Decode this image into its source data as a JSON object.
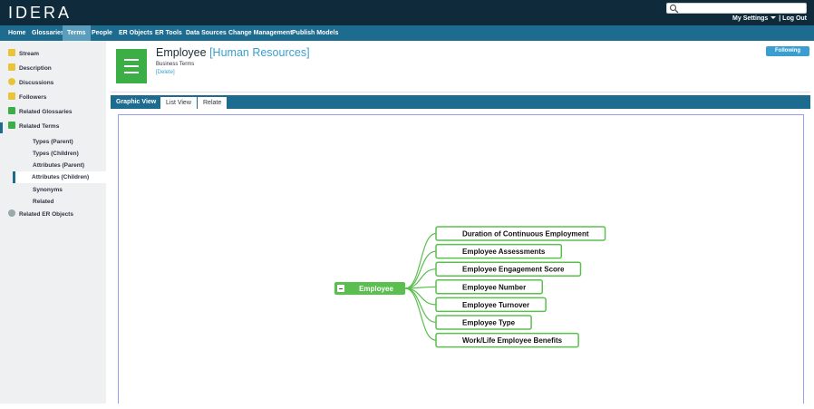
{
  "app": {
    "logo": "IDERA"
  },
  "header": {
    "search_placeholder": "",
    "settings_label": "My Settings",
    "separator": "|",
    "logout_label": "Log Out"
  },
  "nav": {
    "items": [
      "Home",
      "Glossaries",
      "Terms",
      "People",
      "ER Objects",
      "ER Tools",
      "Data Sources",
      "Change Management",
      "Publish Models"
    ],
    "active": "Terms"
  },
  "sidebar": {
    "items": [
      {
        "label": "Stream",
        "icon": "stream-icon",
        "color": "#e9c43a"
      },
      {
        "label": "Description",
        "icon": "description-icon",
        "color": "#e9c43a"
      },
      {
        "label": "Discussions",
        "icon": "discussions-icon",
        "color": "#e9c43a"
      },
      {
        "label": "Followers",
        "icon": "followers-icon",
        "color": "#e9c43a"
      },
      {
        "label": "Related Glossaries",
        "icon": "glossary-icon",
        "color": "#3cae46"
      },
      {
        "label": "Related Terms",
        "icon": "terms-icon",
        "color": "#3cae46"
      },
      {
        "label": "Related ER Objects",
        "icon": "er-objects-icon",
        "color": "#9aa"
      }
    ],
    "sub_items": [
      "Types (Parent)",
      "Types (Children)",
      "Attributes (Parent)",
      "Attributes (Children)",
      "Synonyms",
      "Related"
    ],
    "selected_sub": "Attributes (Children)"
  },
  "term": {
    "name": "Employee",
    "domain": "[Human Resources]",
    "category": "Business Terms",
    "delete_label": "[Delete]",
    "follow_label": "Following",
    "accent": "#3cae46"
  },
  "tabs": {
    "items": [
      "Graphic View",
      "List View",
      "Relate"
    ],
    "active": "Graphic View"
  },
  "graph": {
    "root": "Employee",
    "collapse_symbol": "−",
    "children": [
      "Duration of Continuous Employment",
      "Employee Assessments",
      "Employee Engagement Score",
      "Employee Number",
      "Employee Turnover",
      "Employee Type",
      "Work/Life Employee Benefits"
    ]
  }
}
